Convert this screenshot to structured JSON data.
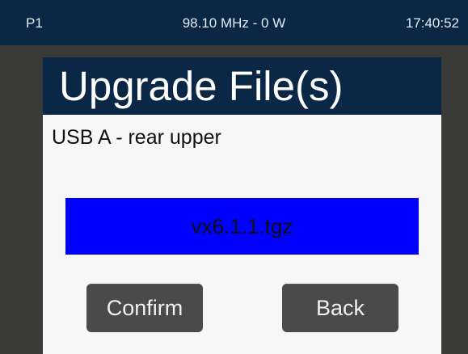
{
  "status_bar": {
    "preset": "P1",
    "frequency_power": "98.10 MHz - 0 W",
    "time": "17:40:52"
  },
  "dialog": {
    "title": "Upgrade File(s)",
    "source": "USB A - rear upper",
    "files": [
      "vx6.1.1.tgz"
    ],
    "selected_file": "vx6.1.1.tgz",
    "selection_color": "#0000ff",
    "confirm_label": "Confirm",
    "back_label": "Back"
  },
  "colors": {
    "header_bg": "#0a2746",
    "background": "#3a3a38",
    "dialog_bg": "#f7f7f7",
    "button_bg": "#4a4a4a"
  }
}
